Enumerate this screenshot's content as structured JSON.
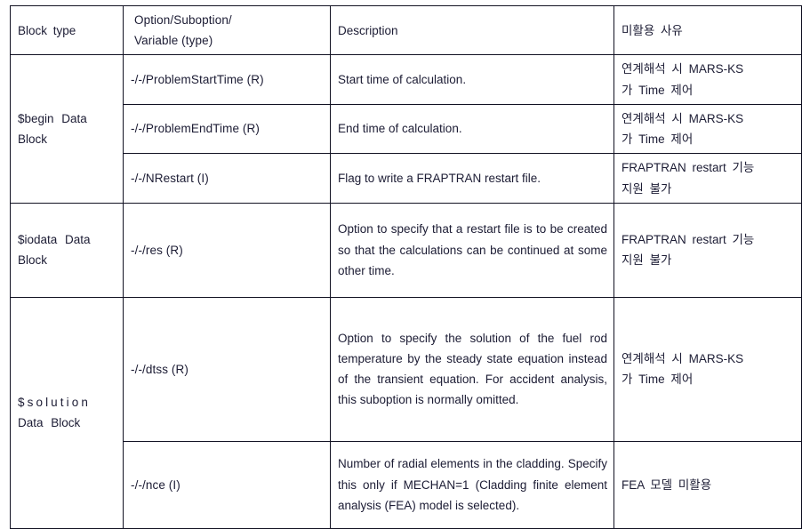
{
  "table": {
    "headers": {
      "block_type": "Block type",
      "option_line1": "Option/Suboption/",
      "option_line2": "Variable (type)",
      "description": "Description",
      "reason": "미활용 사유"
    },
    "groups": [
      {
        "block_type_line1": "$begin  Data",
        "block_type_line2": "Block",
        "rows": [
          {
            "option": "-/-/ProblemStartTime (R)",
            "description": "Start time of calculation.",
            "reason_line1": "연계해석 시  MARS-KS",
            "reason_line2": "가 Time 제어"
          },
          {
            "option": "-/-/ProblemEndTime (R)",
            "description": "End time of calculation.",
            "reason_line1": "연계해석 시  MARS-KS",
            "reason_line2": "가 Time 제어"
          },
          {
            "option": "-/-/NRestart (I)",
            "description": "Flag to write a FRAPTRAN restart file.",
            "reason_line1": "FRAPTRAN restart 기능",
            "reason_line2": "지원 불가"
          }
        ]
      },
      {
        "block_type_line1": "$iodata Data",
        "block_type_line2": "Block",
        "rows": [
          {
            "option": "-/-/res (R)",
            "description": "Option to specify that a restart file is to be created so that the calculations can be continued at some other time.",
            "reason_line1": "FRAPTRAN restart 기능",
            "reason_line2": "지원 불가"
          }
        ]
      },
      {
        "block_type_line1": "$solution",
        "block_type_line2": "Data Block",
        "rows": [
          {
            "option": "-/-/dtss (R)",
            "description": "Option to specify the solution of the fuel rod temperature by the steady state equation instead of the transient equation. For accident analysis, this suboption is normally omitted.",
            "reason_line1": "연계해석 시  MARS-KS",
            "reason_line2": "가 Time 제어"
          },
          {
            "option": "-/-/nce (I)",
            "description": "Number of radial elements in the cladding. Specify this only if MECHAN=1 (Cladding finite element analysis (FEA) model is selected).",
            "reason_line1": "FEA 모델 미활용",
            "reason_line2": ""
          }
        ]
      }
    ]
  },
  "colors": {
    "border": "#111122",
    "text": "#1c1c34",
    "background": "#ffffff"
  }
}
